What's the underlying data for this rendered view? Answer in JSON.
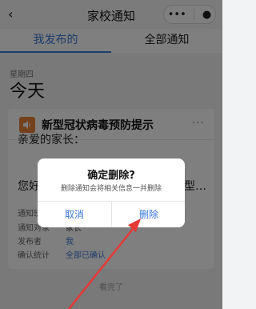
{
  "header": {
    "back": "‹",
    "title": "家校通知",
    "menu": "•••",
    "close": "●"
  },
  "tabs": [
    {
      "label": "我发布的",
      "active": true
    },
    {
      "label": "全部通知",
      "active": false
    }
  ],
  "date_group": {
    "weekday": "星期四",
    "label": "今天"
  },
  "card": {
    "icon": "speaker-icon",
    "title": "新型冠状病毒预防提示",
    "more": "···",
    "greeting": "亲爱的家长：",
    "body_left": "您好",
    "body_right": "型…",
    "meta": [
      {
        "label": "通知班",
        "value": ""
      },
      {
        "label": "通知对象",
        "value": "家长"
      },
      {
        "label": "发布者",
        "value": "我"
      },
      {
        "label": "确认统计",
        "value": "全部已确认"
      }
    ]
  },
  "footer_note": "看完了",
  "dialog": {
    "title": "确定删除?",
    "message": "删除通知会将相关信息一并删除",
    "cancel": "取消",
    "confirm": "删除"
  },
  "colors": {
    "accent": "#3a78d8",
    "icon_orange": "#e8823a",
    "annotation": "#e53935"
  }
}
